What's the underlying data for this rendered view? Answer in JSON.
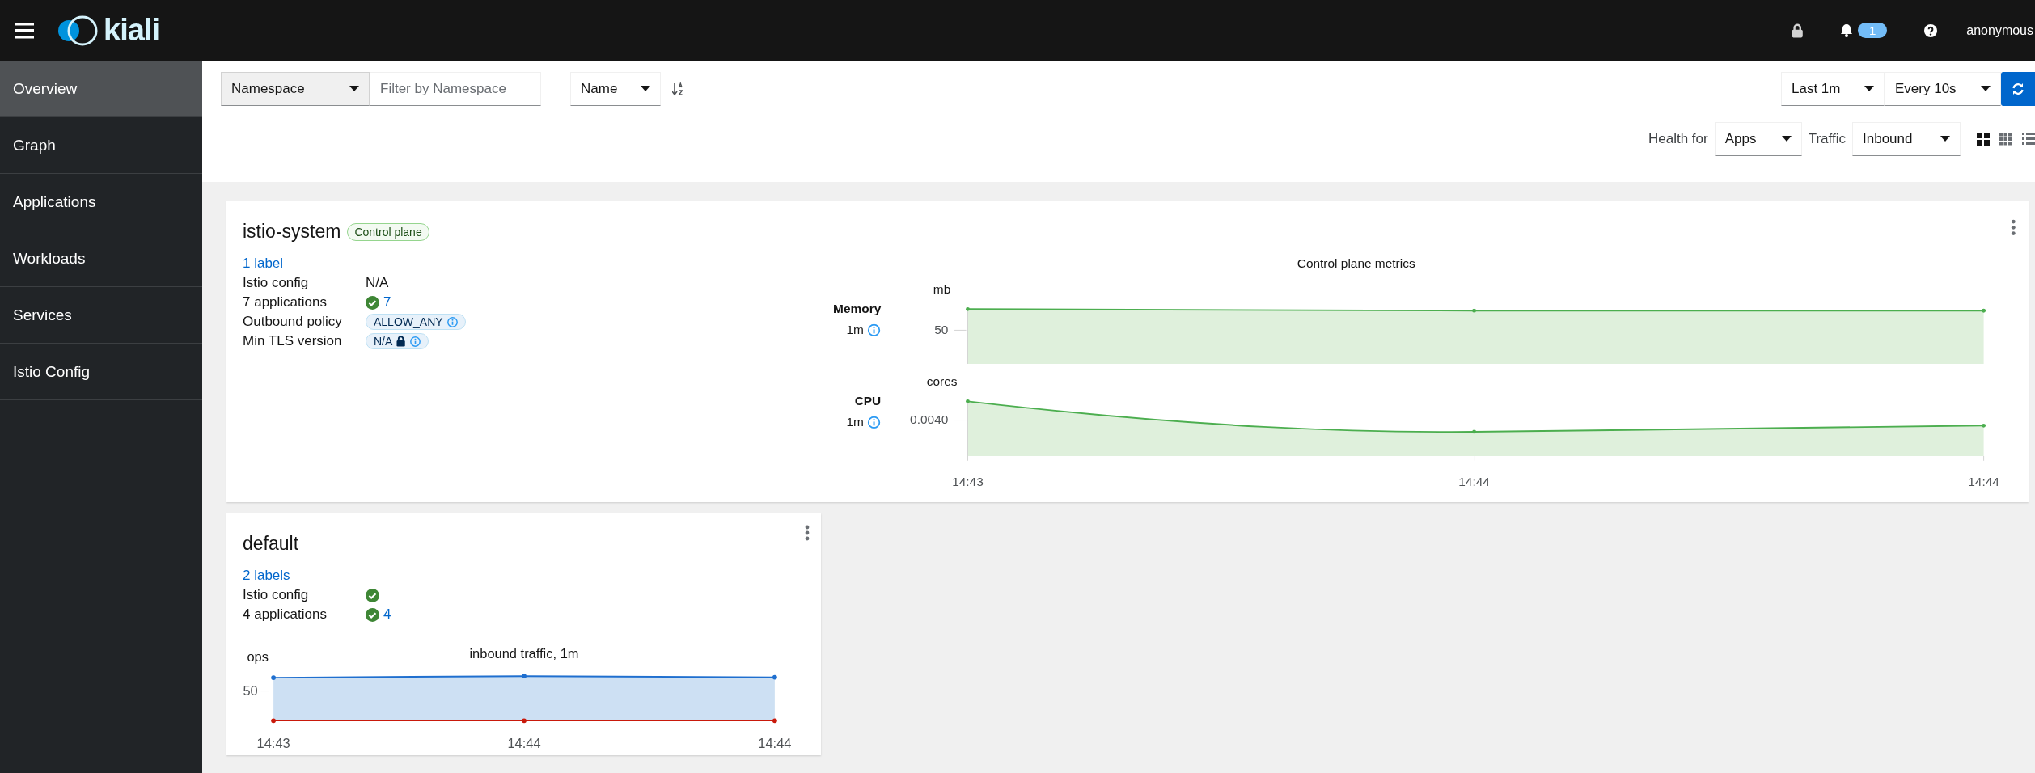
{
  "topbar": {
    "brand": "kiali",
    "notification_count": "1",
    "user": "anonymous"
  },
  "sidebar": {
    "items": [
      {
        "label": "Overview",
        "selected": true
      },
      {
        "label": "Graph",
        "selected": false
      },
      {
        "label": "Applications",
        "selected": false
      },
      {
        "label": "Workloads",
        "selected": false
      },
      {
        "label": "Services",
        "selected": false
      },
      {
        "label": "Istio Config",
        "selected": false
      }
    ]
  },
  "toolbar": {
    "filter_type": "Namespace",
    "filter": {
      "placeholder": "Filter by Namespace"
    },
    "sort_by": "Name",
    "time_range": "Last 1m",
    "refresh_interval": "Every 10s",
    "health_for_label": "Health for",
    "health_for": "Apps",
    "traffic_label": "Traffic",
    "traffic": "Inbound",
    "views": [
      {
        "kind": "large",
        "selected": true
      },
      {
        "kind": "compact",
        "selected": false
      },
      {
        "kind": "list",
        "selected": false
      }
    ]
  },
  "namespaces": [
    {
      "name": "istio-system",
      "badge": "Control plane",
      "labels": "1 label",
      "rows": [
        {
          "label": "Istio config",
          "kind": "text",
          "value": "N/A"
        },
        {
          "label": "7 applications",
          "kind": "status",
          "ok": true,
          "value": "7"
        },
        {
          "label": "Outbound policy",
          "kind": "tag",
          "value": "ALLOW_ANY",
          "lock": false
        },
        {
          "label": "Min TLS version",
          "kind": "tag",
          "value": "N/A",
          "lock": true
        }
      ],
      "chart": {
        "kind": "metrics",
        "title": "Control plane metrics",
        "panels": [
          {
            "name": "Memory",
            "period": "1m",
            "unit": "mb",
            "ytick": "50"
          },
          {
            "name": "CPU",
            "period": "1m",
            "unit": "cores",
            "ytick": "0.0040"
          }
        ],
        "xlabels": [
          "14:43",
          "14:44",
          "14:44"
        ]
      }
    },
    {
      "name": "default",
      "labels": "2 labels",
      "rows": [
        {
          "label": "Istio config",
          "kind": "status",
          "ok": true
        },
        {
          "label": "4 applications",
          "kind": "status",
          "ok": true,
          "value": "4"
        }
      ],
      "chart": {
        "kind": "traffic",
        "title": "inbound traffic, 1m",
        "unit": "ops",
        "ytick": "50",
        "xlabels": [
          "14:43",
          "14:44",
          "14:44"
        ]
      }
    }
  ]
}
